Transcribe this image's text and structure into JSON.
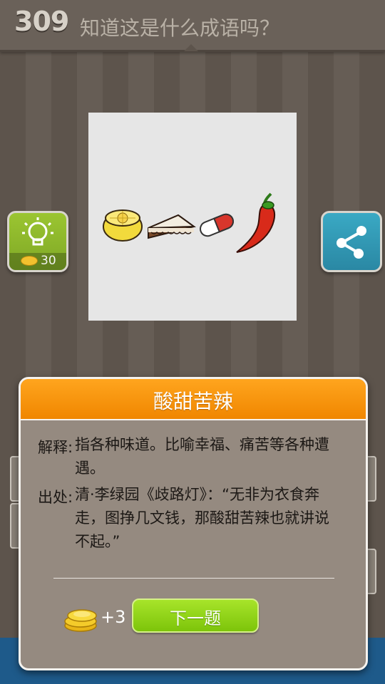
{
  "header": {
    "level": "309",
    "question": "知道这是什么成语吗？"
  },
  "puzzle": {
    "icons": [
      "lemon-icon",
      "cake-icon",
      "pill-icon",
      "chili-icon"
    ]
  },
  "hint": {
    "cost": "30",
    "icon": "lightbulb-icon"
  },
  "share": {
    "icon": "share-icon"
  },
  "dialog": {
    "title": "酸甜苦辣",
    "meaning_label": "解释:",
    "meaning_line1": "指各种味道。比喻幸福、痛苦等各种遭",
    "meaning_line2": "遇。",
    "source_label": "出处:",
    "source_line1": "清·李绿园《歧路灯》：“无非为衣食奔",
    "source_line2": "走，图挣几文钱，那酸甜苦辣也就讲说",
    "source_line3": "不起。”",
    "reward": "+3",
    "next_label": "下一题"
  },
  "colors": {
    "dialog_header": "#f58f0a",
    "next_button": "#8fd21a",
    "hint_button": "#8ab82c",
    "share_button": "#2f97b4"
  }
}
